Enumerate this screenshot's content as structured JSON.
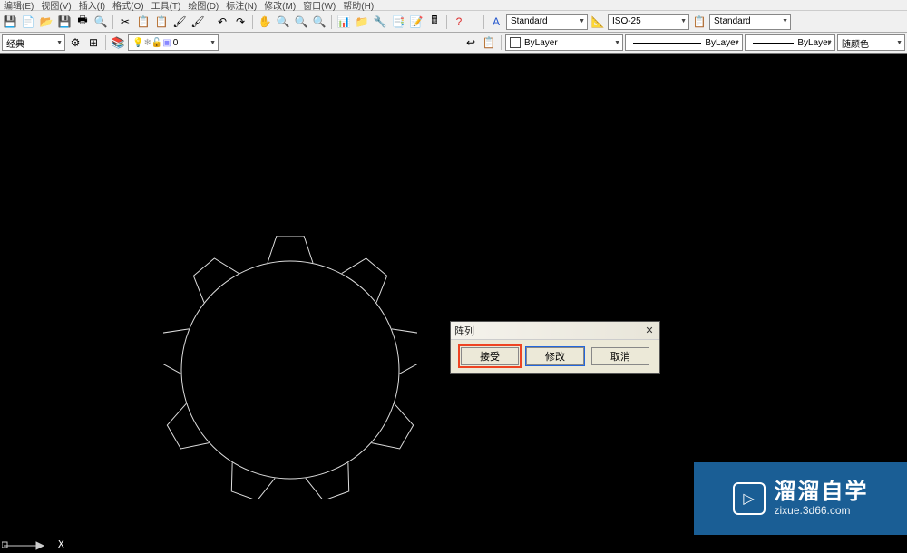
{
  "menu": {
    "items": [
      "编辑(E)",
      "视图(V)",
      "插入(I)",
      "格式(O)",
      "工具(T)",
      "绘图(D)",
      "标注(N)",
      "修改(M)",
      "窗口(W)",
      "帮助(H)"
    ]
  },
  "toolbar1": {
    "style_dd": "Standard",
    "dim_dd": "ISO-25",
    "table_dd": "Standard"
  },
  "toolbar2": {
    "workspace": "经典",
    "layer_state": "0",
    "layer_dd": "ByLayer",
    "linetype_dd": "ByLayer",
    "lineweight_dd": "ByLayer",
    "color_dd": "随颜色"
  },
  "dialog": {
    "title": "阵列",
    "accept": "接受",
    "modify": "修改",
    "cancel": "取消"
  },
  "watermark": {
    "main": "溜溜自学",
    "sub": "zixue.3d66.com"
  },
  "ucs": {
    "x": "X"
  }
}
